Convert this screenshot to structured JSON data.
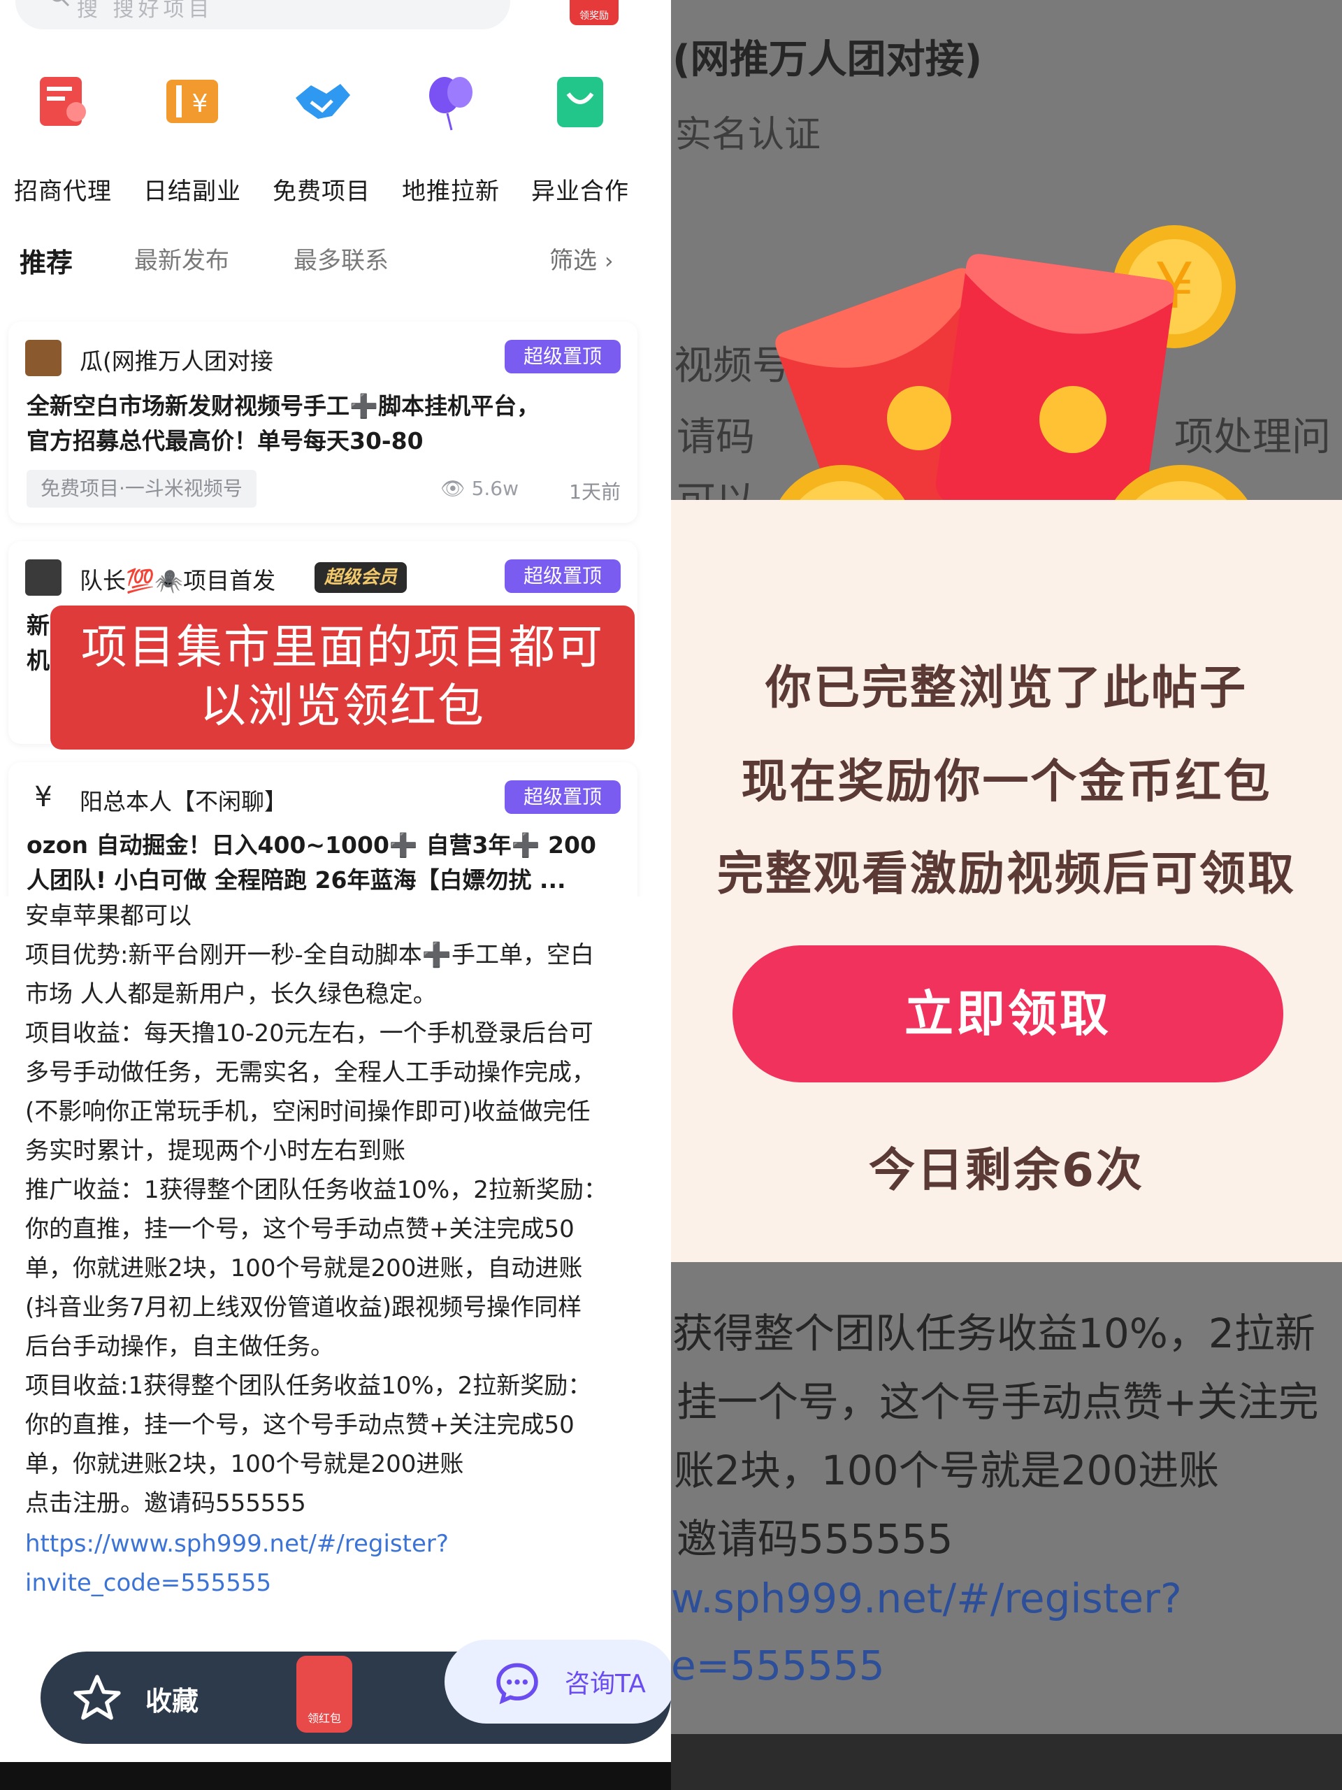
{
  "search": {
    "placeholder": "搜  搜好项目",
    "badge": "领奖励"
  },
  "categories": [
    {
      "label": "招商代理",
      "icon": "merchant-agent-icon",
      "color": "#ef4a4a"
    },
    {
      "label": "日结副业",
      "icon": "daily-pay-icon",
      "color": "#f39a2f"
    },
    {
      "label": "免费项目",
      "icon": "handshake-icon",
      "color": "#2f98f0"
    },
    {
      "label": "地推拉新",
      "icon": "balloon-icon",
      "color": "#7a52f4"
    },
    {
      "label": "异业合作",
      "icon": "shopping-bag-icon",
      "color": "#22c68b"
    }
  ],
  "tabs": {
    "recommend": "推荐",
    "latest": "最新发布",
    "most_contact": "最多联系",
    "filter": "筛选"
  },
  "posts": [
    {
      "author": "瓜(网推万人团对接",
      "pin": "超级置顶",
      "title_line1": "全新空白市场新发财视频号手工➕脚本挂机平台，",
      "title_line2": "官方招募总代最高价！单号每天30-80",
      "tag": "免费项目·一斗米视频号",
      "views": "5.6w",
      "time": "1天前"
    },
    {
      "author": "队长💯🕷️项目首发",
      "vip": "超级会员",
      "pin": "超级置顶",
      "title_line1": "新",
      "title_line2": "机"
    },
    {
      "author": "阳总本人【不闲聊】",
      "pin": "超级置顶",
      "title_line1": "ozon 自动掘金！日入400~1000➕ 自营3年➕ 200",
      "title_line2": "人团队! 小白可做 全程陪跑 26年蓝海【白嫖勿扰 ..."
    }
  ],
  "overlay_banner": {
    "line1": "项目集市里面的项目都可",
    "line2": "以浏览领红包"
  },
  "description": [
    "安卓苹果都可以",
    "项目优势:新平台刚开一秒-全自动脚本➕手工单，空白",
    "市场 人人都是新用户，长久绿色稳定。",
    "项目收益：每天撸10-20元左右，一个手机登录后台可",
    "多号手动做任务，无需实名，全程人工手动操作完成，",
    "(不影响你正常玩手机，空闲时间操作即可)收益做完任",
    "务实时累计，提现两个小时左右到账",
    "推广收益：1获得整个团队任务收益10%，2拉新奖励：",
    "你的直推，挂一个号，这个号手动点赞+关注完成50",
    "单，你就进账2块，100个号就是200进账，自动进账",
    "(抖音业务7月初上线双份管道收益)跟视频号操作同样",
    "后台手动操作，自主做任务。",
    "项目收益:1获得整个团队任务收益10%，2拉新奖励：",
    "你的直推，挂一个号，这个号手动点赞+关注完成50",
    "单，你就进账2块，100个号就是200进账",
    "点击注册。邀请码555555"
  ],
  "link": {
    "line1": "https://www.sph999.net/#/register?",
    "line2": "invite_code=555555"
  },
  "bottom_bar": {
    "favorite": "收藏",
    "red_packet": "领红包",
    "consult": "咨询TA"
  },
  "right_bg": {
    "heading": "(网推万人团对接)",
    "verify": "实名认证",
    "frag1": "视频号",
    "frag2": "请码",
    "frag3": "项处理问",
    "frag4": "可以",
    "line_a": "获得整个团队任务收益10%，2拉新",
    "line_b": "挂一个号，这个号手动点赞+关注完",
    "line_c": "账2块，100个号就是200进账",
    "line_d": "邀请码555555",
    "line_e": "w.sph999.net/#/register?",
    "line_f": "e=555555"
  },
  "popup": {
    "line1": "你已完整浏览了此帖子",
    "line2": "现在奖励你一个金币红包",
    "line3": "完整观看激励视频后可领取",
    "button": "立即领取",
    "remaining": "今日剩余6次"
  }
}
